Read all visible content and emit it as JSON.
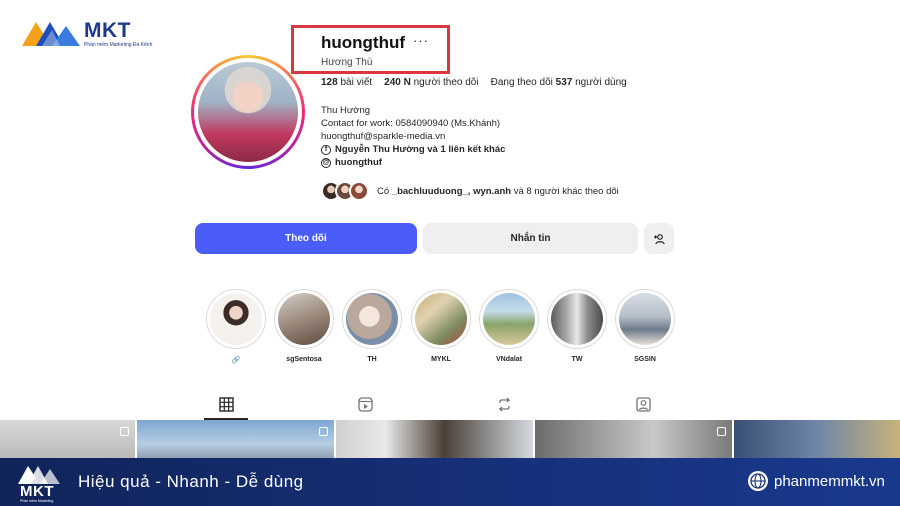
{
  "brand": {
    "name": "MKT",
    "tagline": "Phần mềm Marketing Đa Kênh"
  },
  "profile": {
    "username": "huongthuf",
    "more": "···",
    "full_name": "Hương Thù",
    "stats": {
      "posts_count": "128",
      "posts_label": "bài viết",
      "followers_count": "240 N",
      "followers_label": "người theo dõi",
      "following_prefix": "Đang theo dõi",
      "following_count": "537",
      "following_label": "người dùng"
    },
    "bio": {
      "line1": "Thu Hường",
      "line2": "Contact for work: 0584090940 (Ms.Khánh)",
      "line3": "huongthuf@sparkle-media.vn",
      "facebook_link": "Nguyễn Thu Hường và 1 liên kết khác",
      "threads_handle": "huongthuf"
    },
    "followed_by": {
      "prefix": "Có",
      "users": "_bachluuduong_, wyn.anh",
      "suffix": "và 8 người khác theo dõi"
    }
  },
  "actions": {
    "follow": "Theo dõi",
    "message": "Nhắn tin",
    "suggest_icon": "add-person-icon"
  },
  "highlights": [
    {
      "label": "🔗"
    },
    {
      "label": "sgSentosa"
    },
    {
      "label": "TH"
    },
    {
      "label": "MYKL"
    },
    {
      "label": "VNdalat"
    },
    {
      "label": "TW"
    },
    {
      "label": "SGSIN"
    }
  ],
  "tabs": [
    "grid-icon",
    "reels-icon",
    "reposts-icon",
    "tagged-icon"
  ],
  "banner": {
    "logo": "MKT",
    "logo_sub": "Phần mềm Marketing",
    "slogan": "Hiệu quả - Nhanh  - Dễ dùng",
    "website": "phanmemmkt.vn"
  },
  "colors": {
    "follow_button": "#4a5df9",
    "highlight_box": "#d9363e",
    "banner": "#16307a"
  }
}
